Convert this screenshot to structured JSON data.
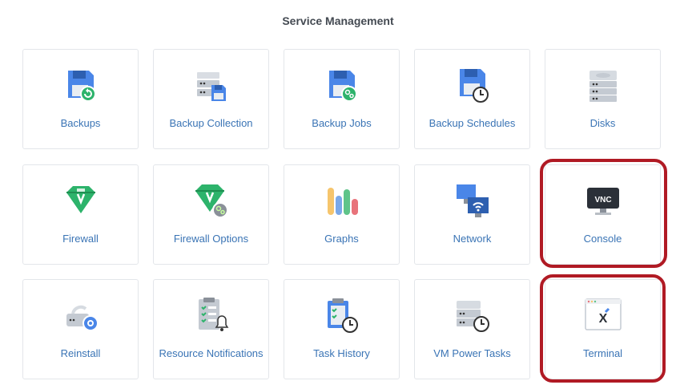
{
  "page": {
    "title": "Service Management"
  },
  "tiles": [
    {
      "label": "Backups"
    },
    {
      "label": "Backup Collection"
    },
    {
      "label": "Backup Jobs"
    },
    {
      "label": "Backup Schedules"
    },
    {
      "label": "Disks"
    },
    {
      "label": "Firewall"
    },
    {
      "label": "Firewall Options"
    },
    {
      "label": "Graphs"
    },
    {
      "label": "Network"
    },
    {
      "label": "Console"
    },
    {
      "label": "Reinstall"
    },
    {
      "label": "Resource Notifications"
    },
    {
      "label": "Task History"
    },
    {
      "label": "VM Power Tasks"
    },
    {
      "label": "Terminal"
    }
  ],
  "console_icon_text": "VNC",
  "terminal_icon_text": "X",
  "colors": {
    "link": "#3a74b5",
    "highlight": "#b01a24",
    "accent_green": "#2db36b"
  }
}
